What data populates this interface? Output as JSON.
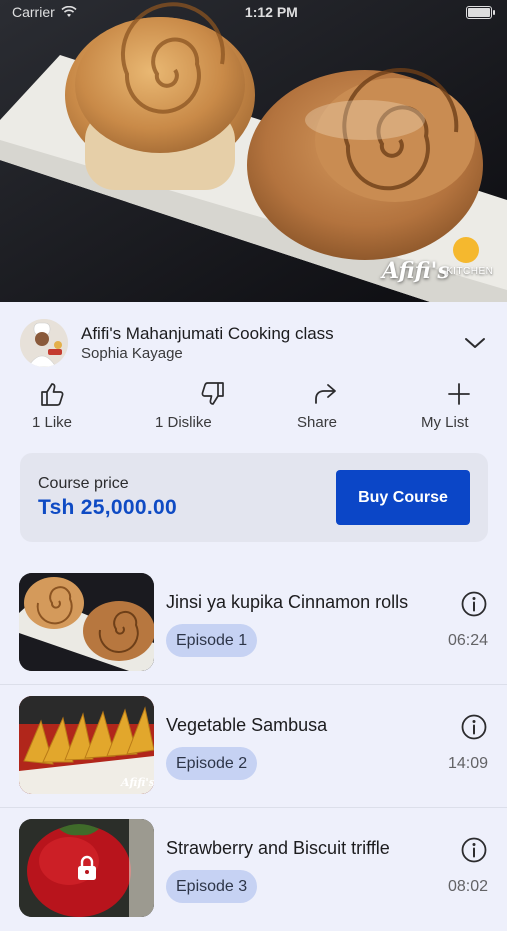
{
  "status_bar": {
    "carrier": "Carrier",
    "time": "1:12 PM"
  },
  "hero": {
    "watermark_brand": "Afifi's",
    "watermark_sub": "KITCHEN"
  },
  "course": {
    "title": "Afifi's Mahanjumati Cooking class",
    "author": "Sophia Kayage"
  },
  "actions": {
    "like_label": "1 Like",
    "dislike_label": "1 Dislike",
    "share_label": "Share",
    "mylist_label": "My List"
  },
  "price_card": {
    "label": "Course price",
    "value": "Tsh 25,000.00",
    "buy_label": "Buy Course"
  },
  "episodes": [
    {
      "title": "Jinsi ya kupika Cinnamon rolls",
      "badge": "Episode 1",
      "duration": "06:24",
      "locked": false,
      "thumb": "cinnamon-rolls"
    },
    {
      "title": "Vegetable Sambusa",
      "badge": "Episode 2",
      "duration": "14:09",
      "locked": false,
      "thumb": "sambusa"
    },
    {
      "title": "Strawberry and Biscuit triffle",
      "badge": "Episode 3",
      "duration": "08:02",
      "locked": true,
      "thumb": "strawberry"
    }
  ],
  "colors": {
    "accent": "#0b46c7",
    "price": "#0f4bc4",
    "badge_bg": "#c6d2f3",
    "background": "#eef0fb"
  },
  "icons": [
    "wifi-icon",
    "battery-icon",
    "chevron-down-icon",
    "thumbs-up-icon",
    "thumbs-down-icon",
    "share-icon",
    "plus-icon",
    "info-icon",
    "lock-icon"
  ]
}
